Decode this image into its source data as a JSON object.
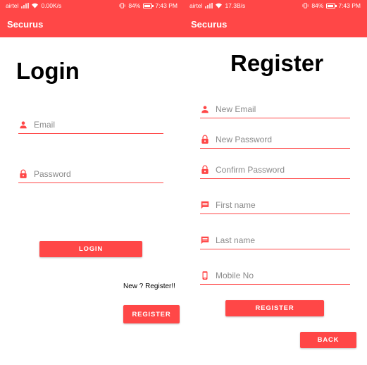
{
  "theme": {
    "accent": "#ff4747",
    "placeholder": "#8a8a8a",
    "text": "#000000"
  },
  "left_screen": {
    "status_bar": {
      "carrier": "airtel",
      "speed": "0.00K/s",
      "battery": "84%",
      "battery_level": 0.84,
      "time": "7:43 PM"
    },
    "app_title": "Securus",
    "heading": "Login",
    "fields": [
      {
        "icon": "person-icon",
        "placeholder": "Email"
      },
      {
        "icon": "lock-icon",
        "placeholder": "Password"
      }
    ],
    "login_button": "LOGIN",
    "register_prompt": "New ? Register!!",
    "register_button": "REGISTER"
  },
  "right_screen": {
    "status_bar": {
      "carrier": "airtel",
      "speed": "17.3B/s",
      "battery": "84%",
      "battery_level": 0.84,
      "time": "7:43 PM"
    },
    "app_title": "Securus",
    "heading": "Register",
    "fields": [
      {
        "icon": "person-icon",
        "placeholder": "New Email"
      },
      {
        "icon": "lock-icon",
        "placeholder": "New Password"
      },
      {
        "icon": "lock-icon",
        "placeholder": "Confirm Password"
      },
      {
        "icon": "message-icon",
        "placeholder": "First name"
      },
      {
        "icon": "message-icon",
        "placeholder": "Last name"
      },
      {
        "icon": "phone-icon",
        "placeholder": "Mobile No"
      }
    ],
    "register_button": "REGISTER",
    "back_button": "BACK"
  }
}
